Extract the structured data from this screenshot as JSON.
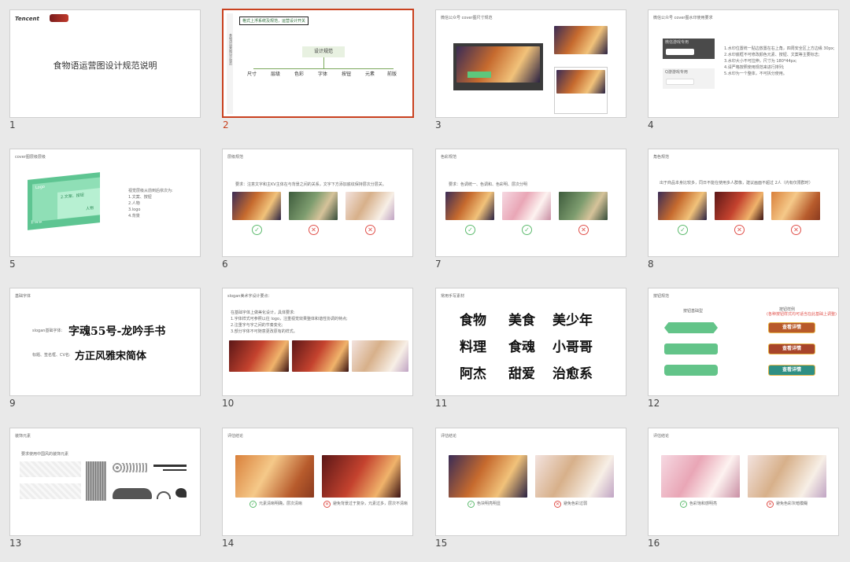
{
  "slides": [
    {
      "num": "1",
      "title": "食物语运营图设计规范说明",
      "logo_tencent": "Tencent"
    },
    {
      "num": "2",
      "header": "格式上浮系统及规范，运营设计开关",
      "center": "设计规范",
      "branches": [
        "尺寸",
        "层级",
        "色彩",
        "字体",
        "按钮",
        "元素",
        "前版"
      ],
      "side_text": "食物语运营图设计规范"
    },
    {
      "num": "3",
      "title": "微信公众号 cover图尺寸规范"
    },
    {
      "num": "4",
      "title": "微信公众号 cover图水印使用要求",
      "label_a": "微信游戏专用",
      "label_b": "Q游游戏专用",
      "lines": [
        "1.水印位置统一贴边放置在右上角，四周安全区上方边缘 30px;",
        "2.水印底框不可修改颜色元素、按钮、文案等主要标志;",
        "3.水印大小不可拉伸，尺寸为 180*44px;",
        "4.请严格按照使用规范来进行排列;",
        "5.水印为一个整体，不可拆分使用。"
      ]
    },
    {
      "num": "5",
      "title": "cover图层级层级",
      "block_a": "Logo",
      "block_b": "2.文案、按钮",
      "block_c": "人物",
      "block_d": "1.背景",
      "lines": [
        "视觉层级从前到后依次为:",
        "1.文案、按钮",
        "2.人物",
        "3.logo",
        "4.背景"
      ]
    },
    {
      "num": "6",
      "title": "层级规范",
      "desc": "要求：注意文字和主KV主体在与背景之间的关系，文字下方添加底纹保持层次分层关。"
    },
    {
      "num": "7",
      "title": "色彩规范",
      "desc": "要求：色调统一、色调和、色彩明、层次分明"
    },
    {
      "num": "8",
      "title": "角色规范",
      "desc": "出于商品本身比较多，同日不能在使用多人群像，建议画面不超过 2人（内有仅限群时）"
    },
    {
      "num": "9",
      "title": "基础字体",
      "label_slogan": "slogan基础字体:",
      "font_slogan": "字魂55号-龙吟手书",
      "label_body": "标题、签名框、CV名:",
      "font_body": "方正风雅宋简体"
    },
    {
      "num": "10",
      "title": "slogan美术字设计要点：",
      "lines": [
        "在基础字体上做美化设计，具体要求:",
        "1.字体样式可参照以往 logo，注重视觉效果整体和谐性协调的特点;",
        "2.注重字与字之间的节奏变化;",
        "3.部分字体不可随意更改原有的样式。"
      ]
    },
    {
      "num": "11",
      "title": "常用手写素材",
      "words": [
        "食物",
        "美食",
        "美少年",
        "料理",
        "食魂",
        "小哥哥",
        "阿杰",
        "甜爱",
        "治愈系"
      ]
    },
    {
      "num": "12",
      "title": "按钮规范",
      "col_a": "按钮基础型",
      "col_b": "按钮样例",
      "col_b_note": "(各种按钮样式均可适当在此基础上调整)",
      "btn_label": "查看详情"
    },
    {
      "num": "13",
      "title": "装饰元素",
      "desc": "要求使用中国风的装饰元素"
    },
    {
      "num": "14",
      "title": "评估结论",
      "ok_text": "元素清晰明确，层次清晰",
      "bad_text": "避免背景过于复杂，元素过多，层次不清晰"
    },
    {
      "num": "15",
      "title": "评估结论",
      "ok_text": "色块明亮明显",
      "bad_text": "避免色彩过弱"
    },
    {
      "num": "16",
      "title": "评估结论",
      "ok_text": "色彩饱和感明亮",
      "bad_text": "避免色彩灰暗模糊"
    }
  ],
  "colors": {
    "selected_border": "#c9411f",
    "check": "#5dbb6e",
    "cross": "#e0504a",
    "button_green": "#63c489"
  },
  "icons": {
    "ok": "check-icon",
    "bad": "cross-icon"
  }
}
